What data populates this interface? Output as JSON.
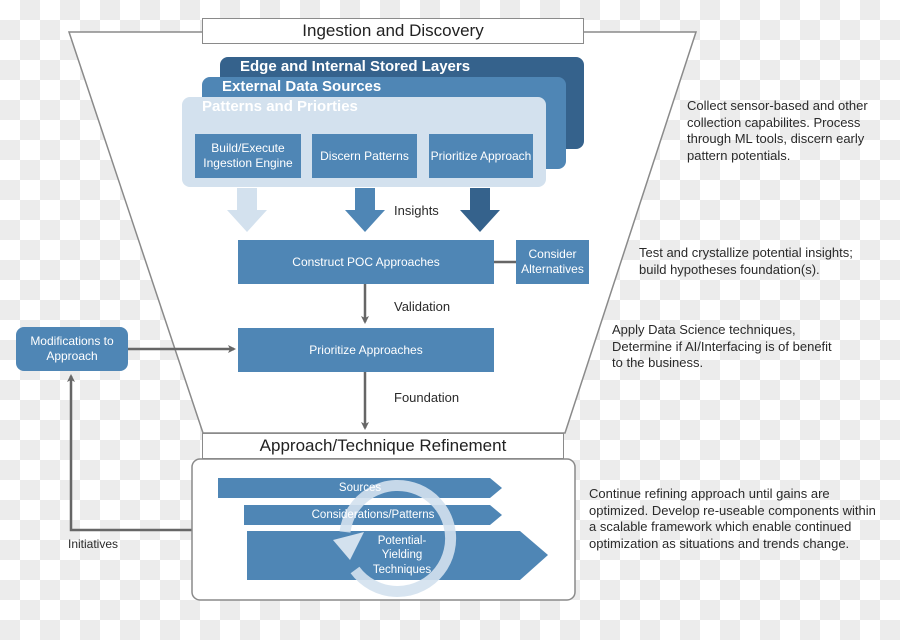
{
  "colors": {
    "dark_blue": "#35628c",
    "mid_blue": "#4f86b5",
    "light_blue": "#d3e1ee",
    "arrow_gray": "#666666",
    "outline_gray": "#8a8a8a"
  },
  "funnel": {
    "top_title": "Ingestion and Discovery",
    "bottom_title": "Approach/Technique Refinement"
  },
  "layers": {
    "back": "Edge and Internal Stored Layers",
    "middle": "External Data Sources",
    "front": "Patterns and Priorties"
  },
  "steps": [
    {
      "label": "Build/Execute Ingestion Engine"
    },
    {
      "label": "Discern Patterns"
    },
    {
      "label": "Prioritize Approach"
    }
  ],
  "flow_labels": {
    "insights": "Insights",
    "validation": "Validation",
    "foundation": "Foundation",
    "initiatives": "Initiatives"
  },
  "nodes": {
    "construct_poc": "Construct POC Approaches",
    "consider_alternatives": "Consider Alternatives",
    "prioritize_approaches": "Prioritize Approaches",
    "modifications": "Modifications to Approach"
  },
  "refinement": {
    "chevrons": [
      "Sources",
      "Considerations/Patterns",
      "Potential-Yielding Techniques"
    ]
  },
  "descriptions": [
    "Collect sensor-based and other collection capabilites. Process through ML tools, discern early pattern potentials.",
    "Test and crystallize potential insights; build hypotheses foundation(s).",
    "Apply Data Science techniques, Determine if AI/Interfacing is of benefit to the business.",
    "Continue refining approach until gains are optimized. Develop re-useable components within a scalable framework which enable continued optimization as situations and trends change."
  ]
}
